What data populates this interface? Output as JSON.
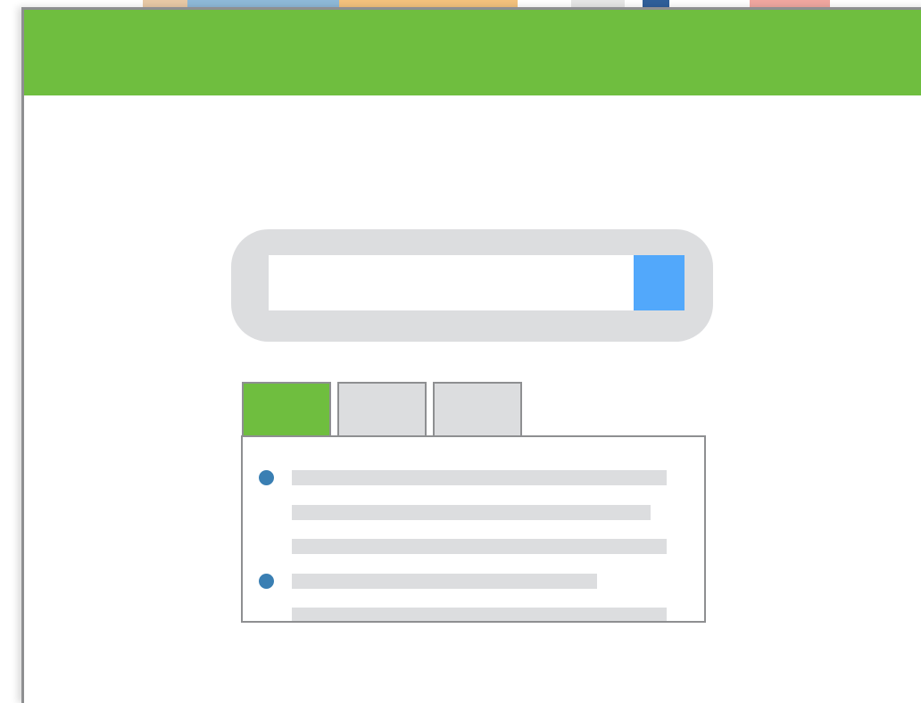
{
  "colors": {
    "accent_green": "#6fbe3f",
    "tab_inactive": "#dcdddf",
    "search_button_blue": "#52a8fb",
    "bullet_blue": "#3a7fb3",
    "border_gray": "#8e8f91",
    "placeholder_gray": "#dcdddf"
  },
  "header": {
    "title": ""
  },
  "search": {
    "value": "",
    "placeholder": "",
    "button_label": ""
  },
  "tabs": [
    {
      "label": "",
      "active": true
    },
    {
      "label": "",
      "active": false
    },
    {
      "label": "",
      "active": false
    }
  ],
  "panel": {
    "items": [
      {
        "bullet": true
      },
      {
        "bullet": false
      },
      {
        "bullet": false
      },
      {
        "bullet": true
      },
      {
        "bullet": false
      }
    ]
  },
  "icons": {
    "search_button": "search-icon",
    "bullet": "bullet-icon"
  }
}
